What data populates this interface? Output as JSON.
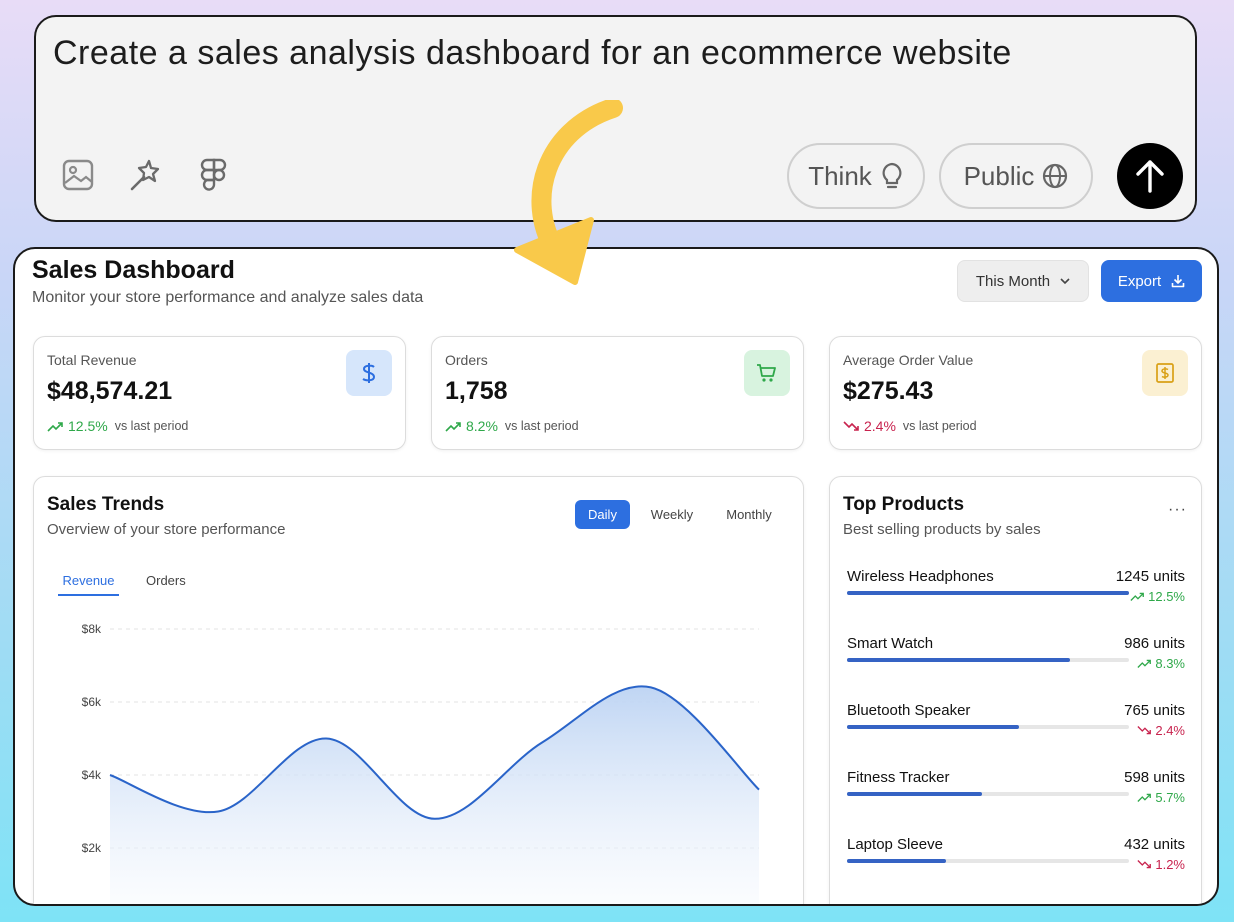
{
  "prompt": {
    "text": "Create a sales analysis dashboard for an ecommerce website",
    "tools": [
      "image-icon",
      "magic-wand-icon",
      "figma-icon"
    ],
    "think_label": "Think",
    "public_label": "Public"
  },
  "dashboard": {
    "title": "Sales Dashboard",
    "subtitle": "Monitor your store performance and analyze sales data",
    "period_label": "This Month",
    "export_label": "Export",
    "stats": [
      {
        "label": "Total Revenue",
        "value": "$48,574.21",
        "change": "12.5%",
        "direction": "up",
        "vs": "vs last period",
        "icon": "dollar-icon",
        "icon_color": "#2d6fe0",
        "icon_bg": "#d6e6fb"
      },
      {
        "label": "Orders",
        "value": "1,758",
        "change": "8.2%",
        "direction": "up",
        "vs": "vs last period",
        "icon": "cart-icon",
        "icon_color": "#2fa84a",
        "icon_bg": "#d8f3df"
      },
      {
        "label": "Average Order Value",
        "value": "$275.43",
        "change": "2.4%",
        "direction": "down",
        "vs": "vs last period",
        "icon": "receipt-icon",
        "icon_color": "#d9a016",
        "icon_bg": "#fbf0d2"
      }
    ],
    "trends": {
      "title": "Sales Trends",
      "subtitle": "Overview of your store performance",
      "segments": [
        "Daily",
        "Weekly",
        "Monthly"
      ],
      "active_segment": "Daily",
      "tabs": [
        "Revenue",
        "Orders"
      ],
      "active_tab": "Revenue"
    },
    "top_products": {
      "title": "Top Products",
      "subtitle": "Best selling products by sales",
      "more_label": "···",
      "items": [
        {
          "name": "Wireless Headphones",
          "units": "1245 units",
          "share": 1.0,
          "change": "12.5%",
          "direction": "up"
        },
        {
          "name": "Smart Watch",
          "units": "986 units",
          "share": 0.79,
          "change": "8.3%",
          "direction": "up"
        },
        {
          "name": "Bluetooth Speaker",
          "units": "765 units",
          "share": 0.61,
          "change": "2.4%",
          "direction": "down"
        },
        {
          "name": "Fitness Tracker",
          "units": "598 units",
          "share": 0.48,
          "change": "5.7%",
          "direction": "up"
        },
        {
          "name": "Laptop Sleeve",
          "units": "432 units",
          "share": 0.35,
          "change": "1.2%",
          "direction": "down"
        }
      ]
    }
  },
  "chart_data": {
    "type": "area",
    "x": [
      0,
      1,
      2,
      3,
      4,
      5,
      6
    ],
    "values": [
      4000,
      3000,
      5000,
      2800,
      4900,
      6400,
      3600
    ],
    "ylim": [
      0,
      8000
    ],
    "yticks": [
      "$2k",
      "$4k",
      "$6k",
      "$8k"
    ],
    "series_color": "#2a64c9",
    "fill_color": "#bcd3f3",
    "grid": true
  },
  "colors": {
    "accent": "#2d6fe0",
    "up": "#2fa84a",
    "down": "#c8234e",
    "arrow": "#f9c94a"
  }
}
